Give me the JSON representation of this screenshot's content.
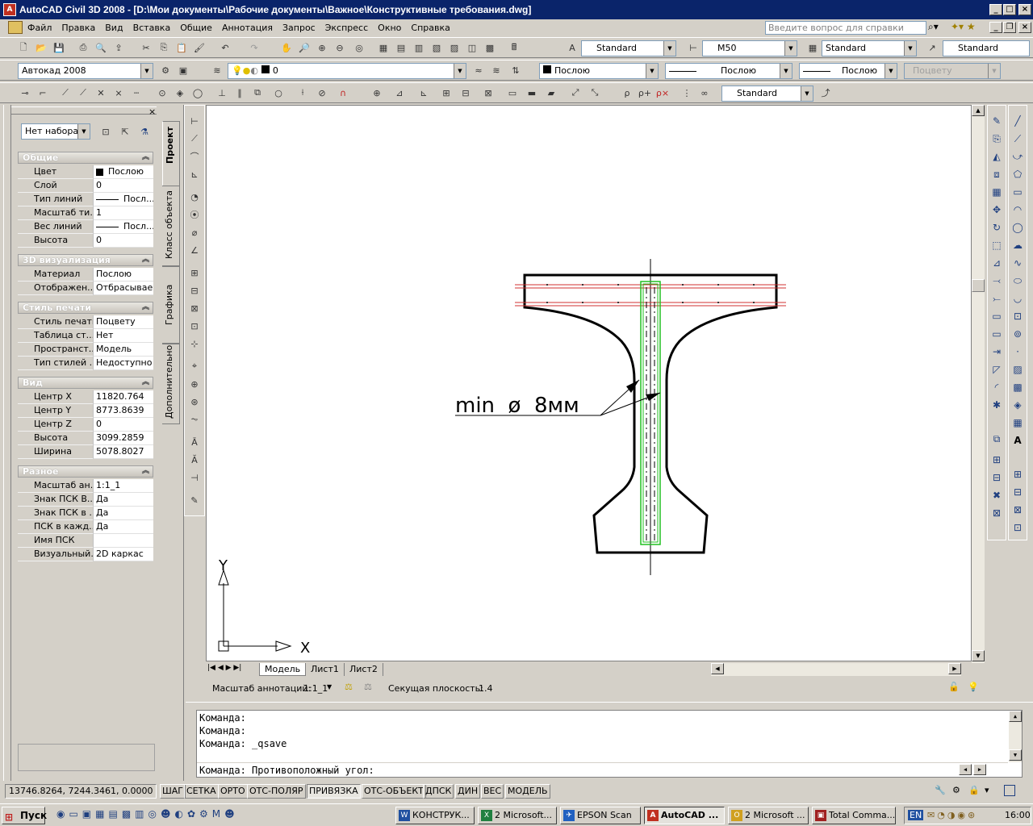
{
  "window": {
    "title": "AutoCAD Civil 3D 2008 - [D:\\Мои документы\\Рабочие документы\\Важное\\Конструктивные требования.dwg]"
  },
  "menu": [
    "Файл",
    "Правка",
    "Вид",
    "Вставка",
    "Общие",
    "Аннотация",
    "Запрос",
    "Экспресс",
    "Окно",
    "Справка"
  ],
  "help_placeholder": "Введите вопрос для справки",
  "toolbars": {
    "text_style": "Standard",
    "dim_style": "M50",
    "table_style": "Standard",
    "multileader_style": "Standard",
    "workspace": "Автокад 2008",
    "layer": "0",
    "color": "Послою",
    "linetype": "Послою",
    "lineweight": "Послою",
    "plotstyle": "Поцвету",
    "dim_style2": "Standard"
  },
  "properties": {
    "selection": "Нет набора",
    "sections": [
      {
        "title": "Общие",
        "rows": [
          [
            "Цвет",
            "Послою"
          ],
          [
            "Слой",
            "0"
          ],
          [
            "Тип линий",
            "Посл..."
          ],
          [
            "Масштаб ти...",
            "1"
          ],
          [
            "Вес линий",
            "Посл..."
          ],
          [
            "Высота",
            "0"
          ]
        ]
      },
      {
        "title": "3D визуализация",
        "rows": [
          [
            "Материал",
            "Послою"
          ],
          [
            "Отображен...",
            "Отбрасывае..."
          ]
        ]
      },
      {
        "title": "Стиль печати",
        "rows": [
          [
            "Стиль печати",
            "Поцвету"
          ],
          [
            "Таблица ст...",
            "Нет"
          ],
          [
            "Пространст...",
            "Модель"
          ],
          [
            "Тип стилей ...",
            "Недоступно"
          ]
        ]
      },
      {
        "title": "Вид",
        "rows": [
          [
            "Центр X",
            "11820.764"
          ],
          [
            "Центр Y",
            "8773.8639"
          ],
          [
            "Центр Z",
            "0"
          ],
          [
            "Высота",
            "3099.2859"
          ],
          [
            "Ширина",
            "5078.8027"
          ]
        ]
      },
      {
        "title": "Разное",
        "rows": [
          [
            "Масштаб ан...",
            "1:1_1"
          ],
          [
            "Знак ПСК В...",
            "Да"
          ],
          [
            "Знак ПСК в ...",
            "Да"
          ],
          [
            "ПСК в кажд...",
            "Да"
          ],
          [
            "Имя ПСК",
            ""
          ],
          [
            "Визуальный...",
            "2D каркас"
          ]
        ]
      }
    ]
  },
  "vtabs": [
    "Проект",
    "Класс объекта",
    "Графика",
    "Дополнительно"
  ],
  "drawing": {
    "annotation": "min  ø  8мм",
    "axis_y": "Y",
    "axis_x": "X"
  },
  "layout_tabs": [
    "Модель",
    "Лист1",
    "Лист2"
  ],
  "annotation_bar": {
    "scale_label": "Масштаб аннотаций:",
    "scale_value": "1:1_1",
    "plane_label": "Секущая плоскость:",
    "plane_value": "1.4"
  },
  "command_lines": [
    "Команда:",
    "Команда:",
    "Команда: _qsave"
  ],
  "command_prompt": "Команда: Противоположный угол:",
  "status": {
    "coords": "13746.8264, 7244.3461, 0.0000",
    "buttons": [
      "ШАГ",
      "СЕТКА",
      "ОРТО",
      "ОТС-ПОЛЯР",
      "ПРИВЯЗКА",
      "ОТС-ОБЪЕКТ",
      "ДПСК",
      "ДИН",
      "ВЕС",
      "МОДЕЛЬ"
    ]
  },
  "taskbar": {
    "start": "Пуск",
    "tasks": [
      "КОНСТРУК...",
      "2 Microsoft...",
      "EPSON Scan",
      "AutoCAD ...",
      "2 Microsoft ...",
      "Total Comma..."
    ],
    "lang": "EN",
    "time": "16:00"
  },
  "colors": {
    "title_bg": "#0a246a",
    "outline": "#000000",
    "rebar": "#d03030",
    "stirrup": "#20c020"
  }
}
